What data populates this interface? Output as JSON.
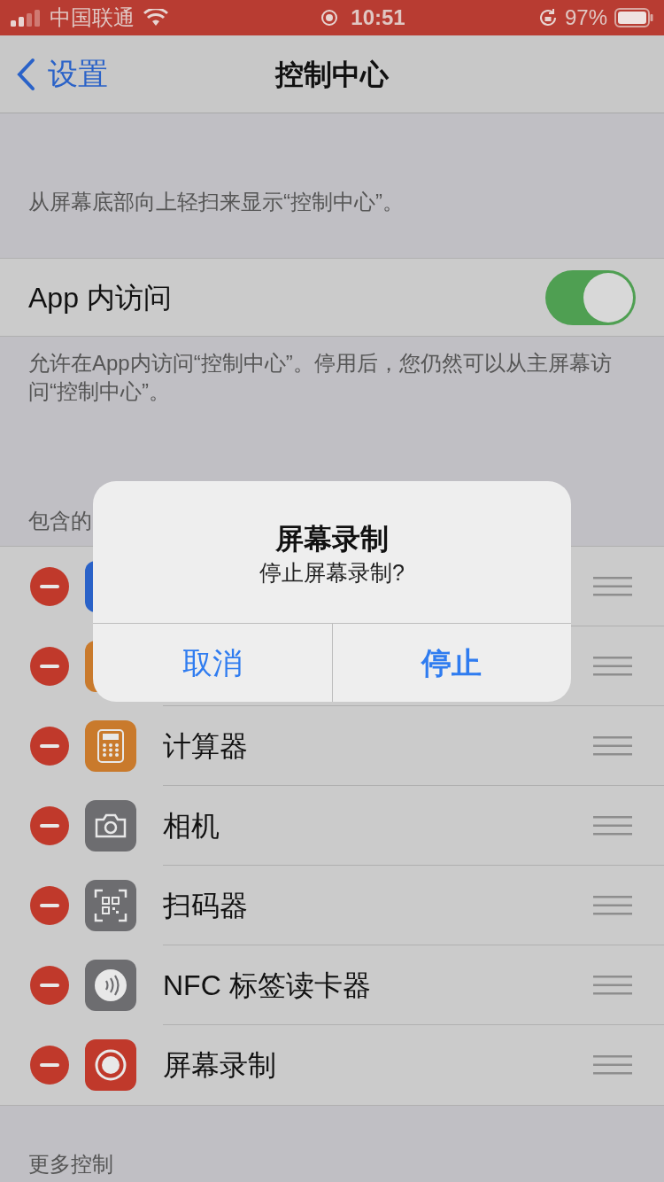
{
  "status_bar": {
    "carrier": "中国联通",
    "time": "10:51",
    "battery": "97%"
  },
  "nav": {
    "back": "设置",
    "title": "控制中心"
  },
  "intro": "从屏幕底部向上轻扫来显示“控制中心”。",
  "access": {
    "label": "App 内访问",
    "on": true
  },
  "access_note": "允许在App内访问“控制中心”。停用后，您仍然可以从主屏幕访问“控制中心”。",
  "included_header": "包含的",
  "controls": [
    {
      "color": "#2a62c8"
    },
    {
      "color": "#c97a2c"
    },
    {
      "label": "计算器",
      "color": "#c97a2c"
    },
    {
      "label": "相机",
      "color": "#6d6d70"
    },
    {
      "label": "扫码器",
      "color": "#6d6d70"
    },
    {
      "label": "NFC 标签读卡器",
      "color": "#6d6d70"
    },
    {
      "label": "屏幕录制",
      "color": "#c0392b"
    }
  ],
  "more_header": "更多控制",
  "alert": {
    "title": "屏幕录制",
    "message": "停止屏幕录制?",
    "buttons": [
      {
        "label": "取消",
        "kind": "cancel"
      },
      {
        "label": "停止",
        "kind": "default"
      }
    ]
  }
}
